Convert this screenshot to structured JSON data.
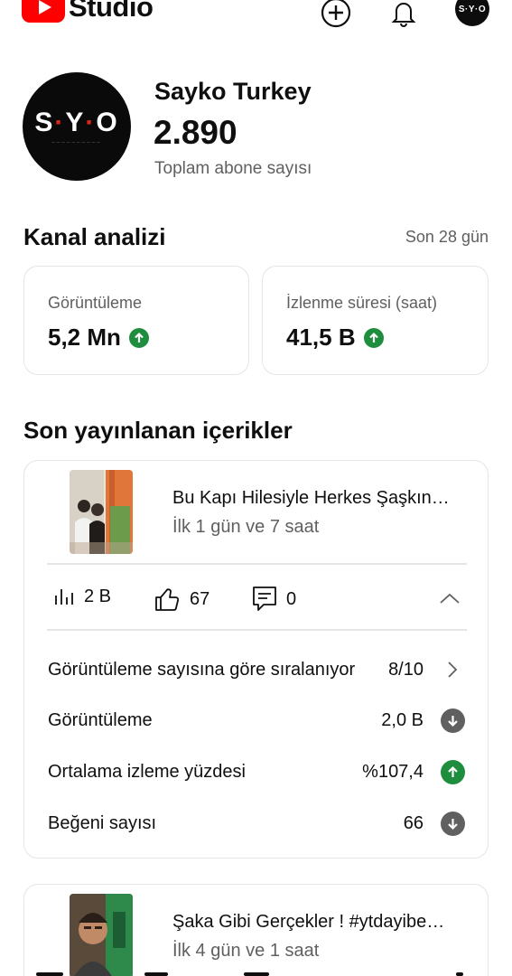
{
  "app": {
    "logo_text": "Studio",
    "avatar_text": "S·Y·O"
  },
  "channel": {
    "avatar_logo_left": "S",
    "avatar_logo_mid": "Y",
    "avatar_logo_right": "O",
    "name": "Sayko Turkey",
    "subscribers": "2.890",
    "subscribers_label": "Toplam abone sayısı"
  },
  "analytics": {
    "title": "Kanal analizi",
    "period": "Son 28 gün",
    "metrics": [
      {
        "label": "Görüntüleme",
        "value": "5,2 Mn",
        "trend": "up"
      },
      {
        "label": "İzlenme süresi (saat)",
        "value": "41,5 B",
        "trend": "up"
      }
    ]
  },
  "recent": {
    "title": "Son yayınlanan içerikler",
    "videos": [
      {
        "title": "Bu Kapı Hilesiyle Herkes Şaşkın…",
        "age": "İlk 1 gün ve 7 saat",
        "views_short": "2 B",
        "likes": "67",
        "comments": "0",
        "rows": [
          {
            "label": "Görüntüleme sayısına göre sıralanıyor",
            "value": "8/10",
            "icon": "chevron-right-icon"
          },
          {
            "label": "Görüntüleme",
            "value": "2,0 B",
            "icon": "arrow-down-circle-icon"
          },
          {
            "label": "Ortalama izleme yüzdesi",
            "value": "%107,4",
            "icon": "arrow-up-circle-icon"
          },
          {
            "label": "Beğeni sayısı",
            "value": "66",
            "icon": "arrow-down-circle-icon"
          }
        ]
      },
      {
        "title": "Şaka Gibi Gerçekler ! #ytdayibe…",
        "age": "İlk 4 gün ve 1 saat"
      }
    ]
  },
  "colors": {
    "brand_red": "#ff0000",
    "trend_up": "#1e8e3e",
    "trend_down": "#606060"
  }
}
